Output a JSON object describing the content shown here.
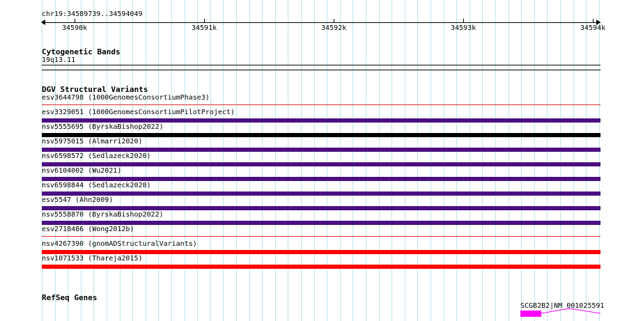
{
  "ruler": {
    "location": "chr19:34589739..34594049",
    "ticks": [
      "34590k",
      "34591k",
      "34592k",
      "34593k",
      "34594k"
    ]
  },
  "cytoband": {
    "title": "Cytogenetic Bands",
    "band_label": "19q13.11"
  },
  "dgv": {
    "title": "DGV Structural Variants",
    "variants": [
      {
        "label": "esv3644798 (1000GenomesConsortiumPhase3)",
        "color": "#dc2a2a",
        "style": "thin"
      },
      {
        "label": "esv3329051 (1000GenomesConsortiumPilotProject)",
        "color": "#4b0f82",
        "style": "thick"
      },
      {
        "label": "nsv5555695 (ByrskaBishop2022)",
        "color": "#000000",
        "style": "thick"
      },
      {
        "label": "nsv5975015 (Almarri2020)",
        "color": "#4b0f82",
        "style": "thick"
      },
      {
        "label": "nsv6598572 (Sedlazeck2020)",
        "color": "#4b0f82",
        "style": "thick"
      },
      {
        "label": "nsv6104002 (Wu2021)",
        "color": "#4b0f82",
        "style": "thick"
      },
      {
        "label": "nsv6598844 (Sedlazeck2020)",
        "color": "#4b0f82",
        "style": "thick"
      },
      {
        "label": "esv5547 (Ahn2009)",
        "color": "#4b0f82",
        "style": "thick"
      },
      {
        "label": "nsv5558870 (ByrskaBishop2022)",
        "color": "#4b0f82",
        "style": "thick"
      },
      {
        "label": "esv2718486 (Wong2012b)",
        "color": "#dc2a2a",
        "style": "thin"
      },
      {
        "label": "nsv4267390 (gnomADStructuralVariants)",
        "color": "#ff0000",
        "style": "thick"
      },
      {
        "label": "nsv1071533 (Thareja2015)",
        "color": "#ff0000",
        "style": "thick"
      }
    ]
  },
  "refseq": {
    "title": "RefSeq Genes",
    "gene_label": "SCGB2B2|NM_001025591",
    "exon_color": "#ff00ff",
    "intron_color": "#ff00ff"
  }
}
